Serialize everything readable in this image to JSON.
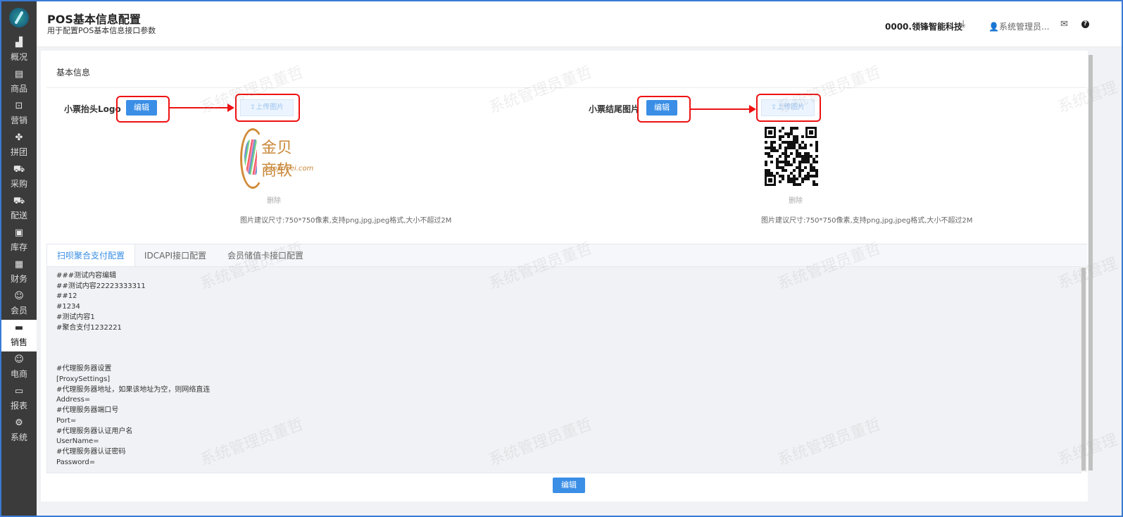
{
  "sidebar": {
    "items": [
      {
        "label": "概况",
        "icon": "chart-icon"
      },
      {
        "label": "商品",
        "icon": "document-icon"
      },
      {
        "label": "营销",
        "icon": "bag-icon"
      },
      {
        "label": "拼团",
        "icon": "grid-icon"
      },
      {
        "label": "采购",
        "icon": "cart-icon"
      },
      {
        "label": "配送",
        "icon": "truck-icon"
      },
      {
        "label": "库存",
        "icon": "box-icon"
      },
      {
        "label": "财务",
        "icon": "printer-icon"
      },
      {
        "label": "会员",
        "icon": "person-icon"
      },
      {
        "label": "销售",
        "icon": "register-icon",
        "active": true
      },
      {
        "label": "电商",
        "icon": "person-icon"
      },
      {
        "label": "报表",
        "icon": "monitor-icon"
      },
      {
        "label": "系统",
        "icon": "gear-icon"
      }
    ]
  },
  "header": {
    "title": "POS基本信息配置",
    "subtitle": "用于配置POS基本信息接口参数",
    "company": "0000.领锋智能科技",
    "user": "系统管理员..."
  },
  "basic": {
    "section_title": "基本信息",
    "logo_label": "小票抬头Logo",
    "tail_label": "小票结尾图片",
    "edit_label": "编辑",
    "upload_label": "上传图片",
    "delete_label": "删除",
    "hint": "图片建议尺寸:750*750像素,支持png,jpg,jpeg格式,大小不超过2M",
    "logo_text": "金贝商软",
    "logo_sub": "yunjinbei.com"
  },
  "tabs": [
    "扫呗聚合支付配置",
    "IDCAPI接口配置",
    "会员储值卡接口配置"
  ],
  "editor": {
    "lines": [
      "###测试内容编辑",
      "##测试内容22223333311",
      "##12",
      "#1234",
      "#测试内容1",
      "#聚合支付1232221",
      "",
      "",
      "",
      "#代理服务器设置",
      "[ProxySettings]",
      "#代理服务器地址，如果该地址为空，则网络直连",
      "Address=",
      "#代理服务器端口号",
      "Port=",
      "#代理服务器认证用户名",
      "UserName=",
      "#代理服务器认证密码",
      "Password="
    ]
  },
  "footer": {
    "edit_label": "编辑"
  },
  "watermark": "系统管理员董哲"
}
